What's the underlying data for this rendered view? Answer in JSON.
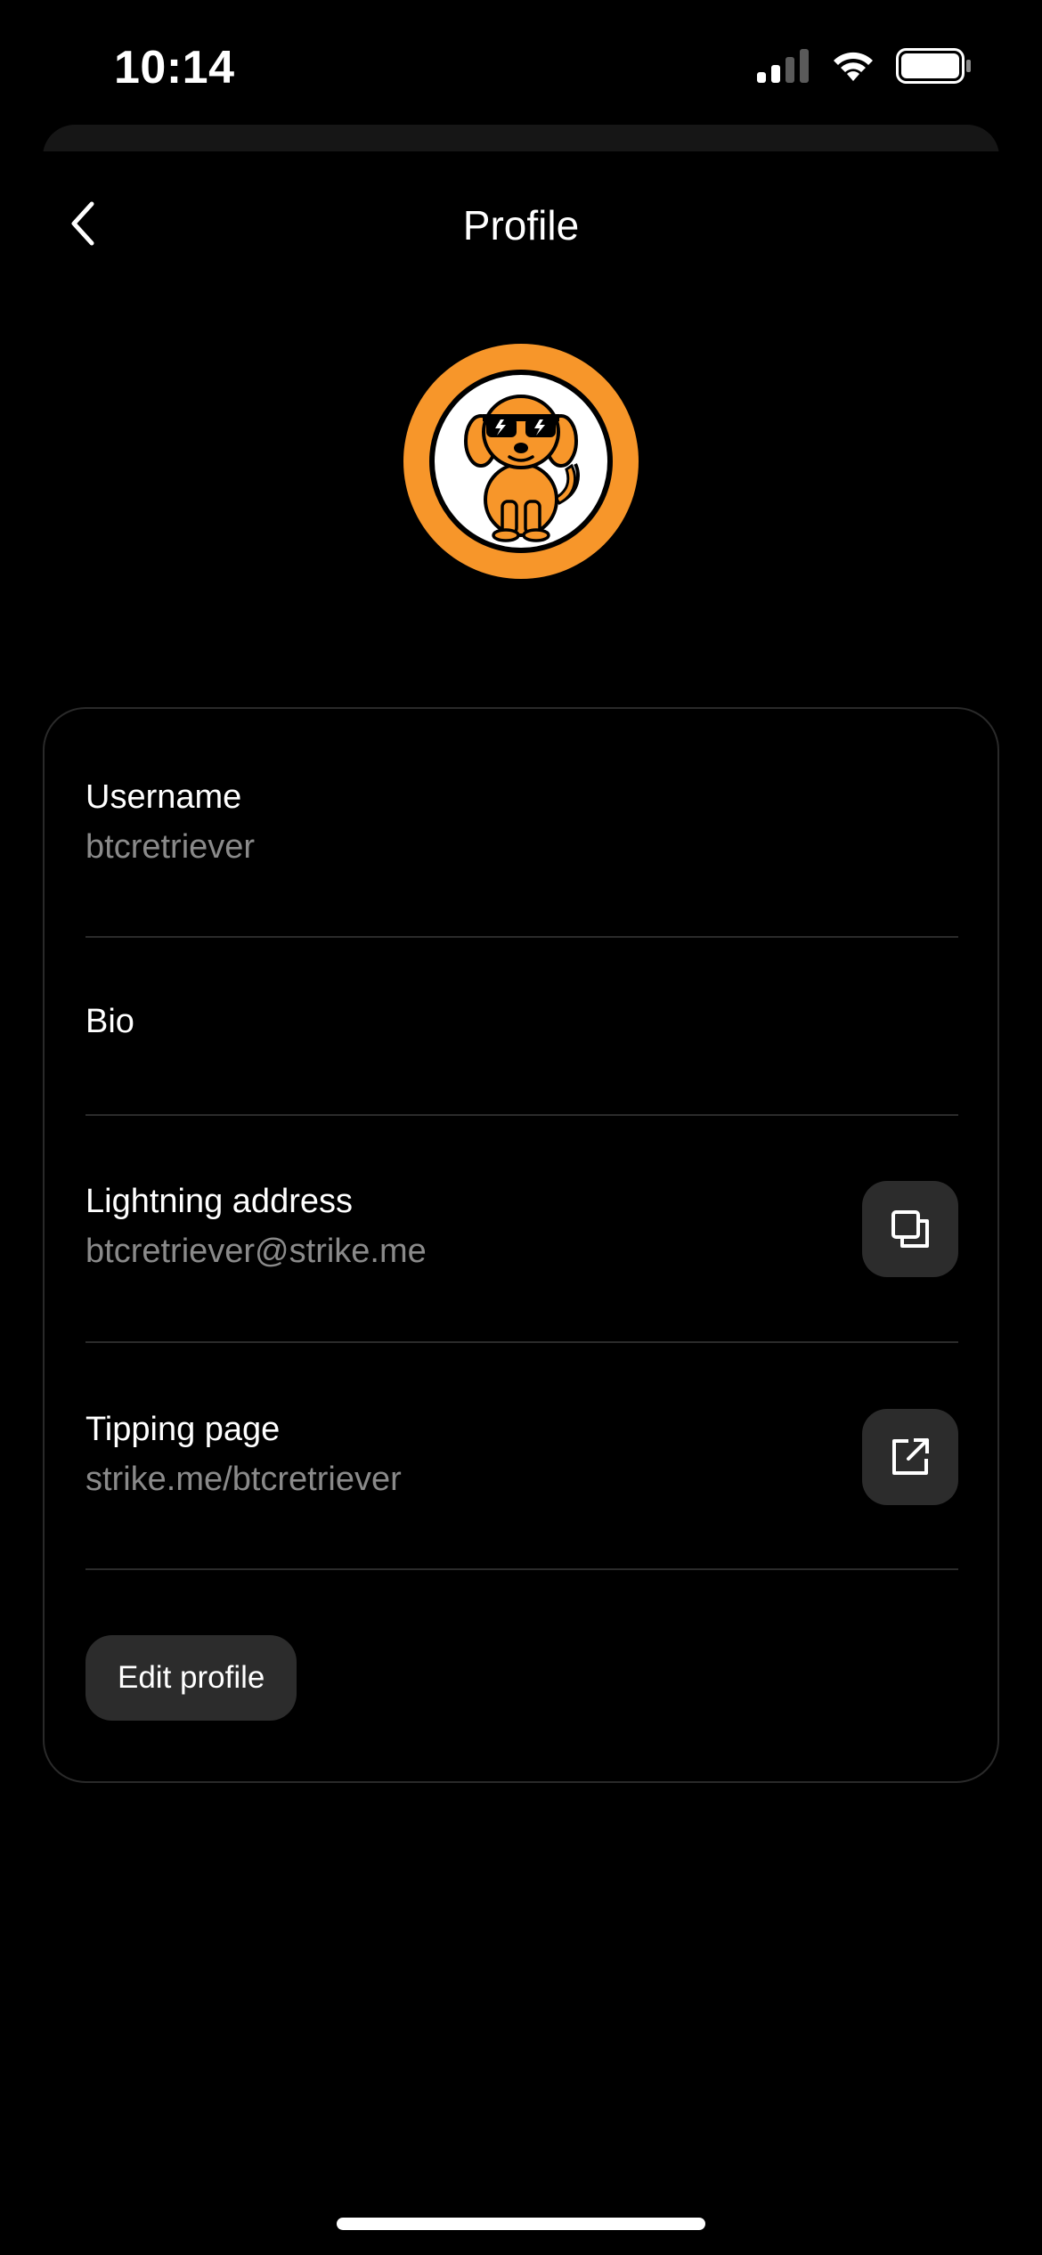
{
  "status_bar": {
    "time": "10:14"
  },
  "header": {
    "title": "Profile",
    "back_icon": "chevron-left-icon"
  },
  "avatar": {
    "ring_color": "#f7962a",
    "icon": "dog-with-sunglasses"
  },
  "profile": {
    "username": {
      "label": "Username",
      "value": "btcretriever"
    },
    "bio": {
      "label": "Bio"
    },
    "lightning_address": {
      "label": "Lightning address",
      "value": "btcretriever@strike.me",
      "action_icon": "copy-icon"
    },
    "tipping_page": {
      "label": "Tipping page",
      "value": "strike.me/btcretriever",
      "action_icon": "external-link-icon"
    },
    "edit_button_label": "Edit profile"
  },
  "colors": {
    "background": "#000000",
    "accent": "#f7962a",
    "secondary_text": "#8a8a8a",
    "button_bg": "#2c2c2c"
  }
}
